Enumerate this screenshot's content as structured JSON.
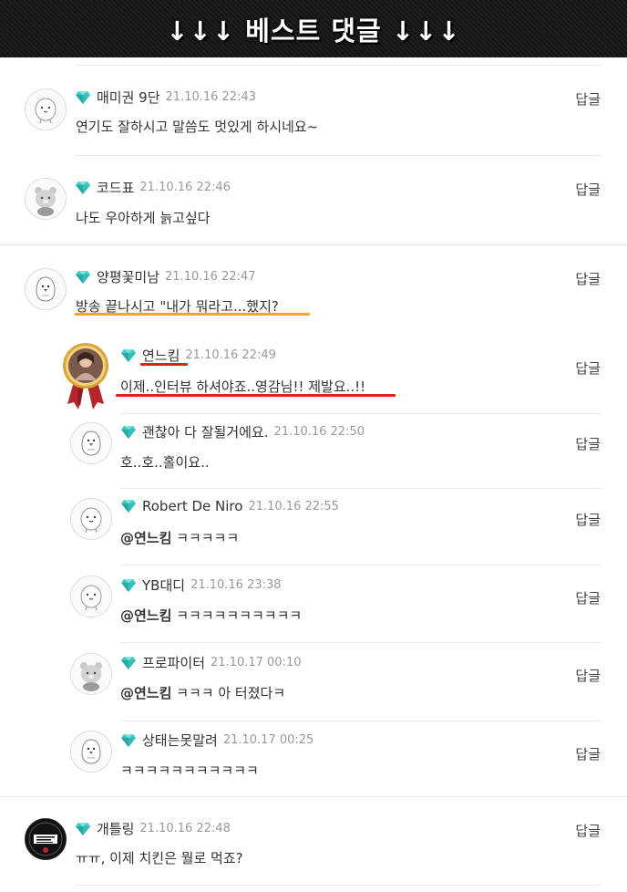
{
  "banner": {
    "title": "↓↓↓ 베스트 댓글 ↓↓↓"
  },
  "reply_label": "답글",
  "comments": [
    {
      "nick": "매미권 9단",
      "date": "21.10.16 22:43",
      "text": "연기도 잘하시고 말씀도 멋있게 하시네요~"
    },
    {
      "nick": "코드표",
      "date": "21.10.16 22:46",
      "text": "나도 우아하게 늙고싶다"
    },
    {
      "nick": "양평꽃미남",
      "date": "21.10.16 22:47",
      "text": "방송 끝나시고 \"내가 뭐라고...했지?"
    },
    {
      "nick": "개틀링",
      "date": "21.10.16 22:48",
      "text": "ㅠㅠ, 이제 치킨은 뭘로 먹죠?"
    }
  ],
  "replies": [
    {
      "nick": "연느킴",
      "date": "21.10.16 22:49",
      "mention": "",
      "text": "이제..인터뷰 하셔야죠..영감님!! 제발요..!!"
    },
    {
      "nick": "괜찮아 다 잘될거에요.",
      "date": "21.10.16 22:50",
      "mention": "",
      "text": "호..호..홀이요.."
    },
    {
      "nick": "Robert De Niro",
      "date": "21.10.16 22:55",
      "mention": "@연느킴",
      "text": "ㅋㅋㅋㅋㅋ"
    },
    {
      "nick": "YB대디",
      "date": "21.10.16 23:38",
      "mention": "@연느킴",
      "text": "ㅋㅋㅋㅋㅋㅋㅋㅋㅋㅋ"
    },
    {
      "nick": "프로파이터",
      "date": "21.10.17 00:10",
      "mention": "@연느킴",
      "text": "ㅋㅋㅋ 아 터졌다ㅋ"
    },
    {
      "nick": "상태는못말려",
      "date": "21.10.17 00:25",
      "mention": "",
      "text": "ㅋㅋㅋㅋㅋㅋㅋㅋㅋㅋㅋ"
    }
  ],
  "colors": {
    "gem": "#3ec9c4",
    "orange_underline": "#f5a623",
    "red_underline": "#e01e1e",
    "medal_ribbon": "#b3262b",
    "medal_gold": "#d8a53a"
  }
}
